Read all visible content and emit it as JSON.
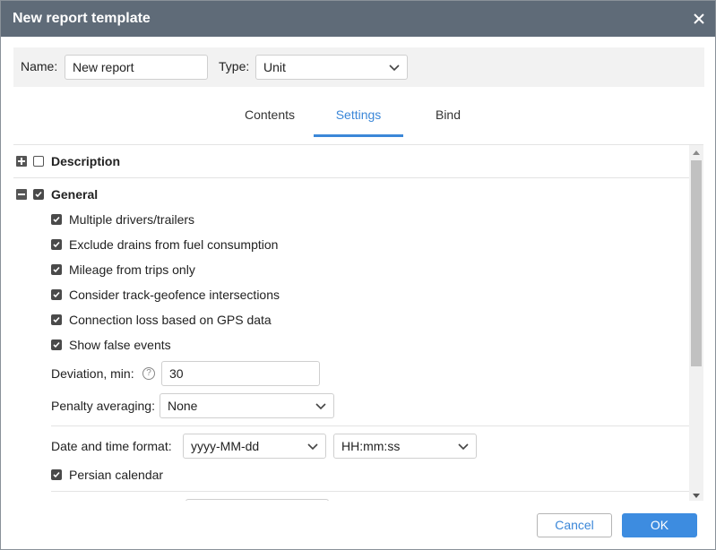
{
  "dialog": {
    "title": "New report template"
  },
  "header": {
    "name_label": "Name:",
    "name_value": "New report",
    "type_label": "Type:",
    "type_value": "Unit"
  },
  "tabs": [
    {
      "label": "Contents",
      "active": false
    },
    {
      "label": "Settings",
      "active": true
    },
    {
      "label": "Bind",
      "active": false
    }
  ],
  "sections": {
    "description": {
      "label": "Description",
      "expanded": false,
      "checked": false
    },
    "general": {
      "label": "General",
      "expanded": true,
      "checked": true,
      "options": [
        {
          "label": "Multiple drivers/trailers",
          "checked": true
        },
        {
          "label": "Exclude drains from fuel consumption",
          "checked": true
        },
        {
          "label": "Mileage from trips only",
          "checked": true
        },
        {
          "label": "Consider track-geofence intersections",
          "checked": true
        },
        {
          "label": "Connection loss based on GPS data",
          "checked": true
        },
        {
          "label": "Show false events",
          "checked": true
        }
      ],
      "deviation_label": "Deviation, min:",
      "deviation_value": "30",
      "penalty_label": "Penalty averaging:",
      "penalty_value": "None",
      "datetime_label": "Date and time format:",
      "date_format": "yyyy-MM-dd",
      "time_format": "HH:mm:ss",
      "persian_label": "Persian calendar",
      "persian_checked": true
    }
  },
  "footer": {
    "cancel_label": "Cancel",
    "ok_label": "OK"
  },
  "colors": {
    "titlebar": "#5f6b78",
    "accent": "#3b87d8",
    "ok_button": "#3d8ce0"
  }
}
